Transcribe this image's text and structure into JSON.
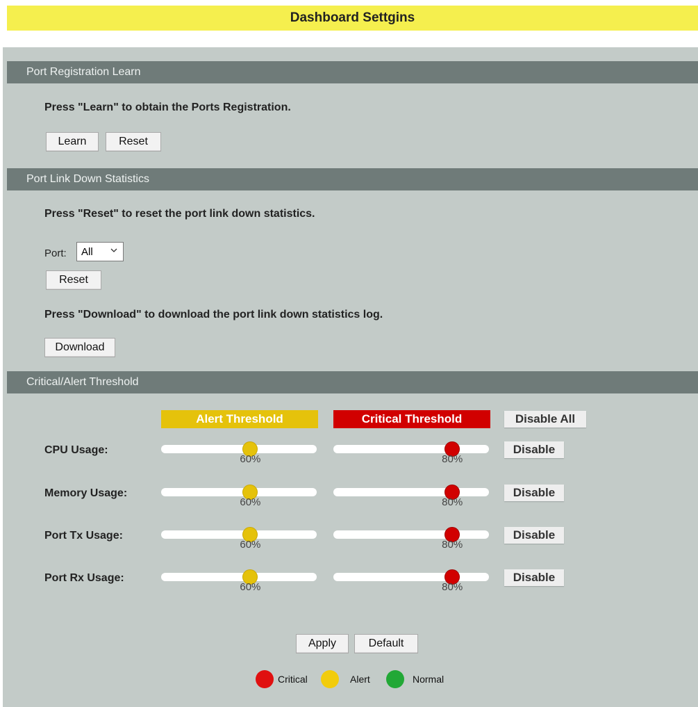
{
  "title": "Dashboard Settgins",
  "sections": {
    "learn": {
      "header": "Port Registration Learn",
      "instruction": "Press \"Learn\" to obtain the Ports Registration.",
      "learn_button": "Learn",
      "reset_button": "Reset"
    },
    "linkdown": {
      "header": "Port Link Down Statistics",
      "instruction": "Press \"Reset\" to reset the port link down statistics.",
      "port_label": "Port:",
      "port_value": "All",
      "reset_button": "Reset",
      "download_instruction": "Press \"Download\" to download the port link down statistics log.",
      "download_button": "Download"
    },
    "threshold": {
      "header": "Critical/Alert Threshold",
      "alert_header": "Alert Threshold",
      "critical_header": "Critical Threshold",
      "disable_all_button": "Disable All",
      "rows": [
        {
          "label": "CPU Usage:",
          "alert_value": 60,
          "alert_text": "60%",
          "critical_value": 80,
          "critical_text": "80%",
          "disable_button": "Disable"
        },
        {
          "label": "Memory Usage:",
          "alert_value": 60,
          "alert_text": "60%",
          "critical_value": 80,
          "critical_text": "80%",
          "disable_button": "Disable"
        },
        {
          "label": "Port Tx Usage:",
          "alert_value": 60,
          "alert_text": "60%",
          "critical_value": 80,
          "critical_text": "80%",
          "disable_button": "Disable"
        },
        {
          "label": "Port Rx Usage:",
          "alert_value": 60,
          "alert_text": "60%",
          "critical_value": 80,
          "critical_text": "80%",
          "disable_button": "Disable"
        }
      ],
      "apply_button": "Apply",
      "default_button": "Default"
    }
  },
  "legend": [
    {
      "label": "Critical",
      "color": "#e01010"
    },
    {
      "label": "Alert",
      "color": "#f2cc0c"
    },
    {
      "label": "Normal",
      "color": "#22a836"
    }
  ],
  "colors": {
    "title_bg": "#f5ef4e",
    "section_header_bg": "#6f7b79",
    "panel_bg": "#c3cbc8",
    "alert": "#e5c20b",
    "critical": "#d10000"
  }
}
